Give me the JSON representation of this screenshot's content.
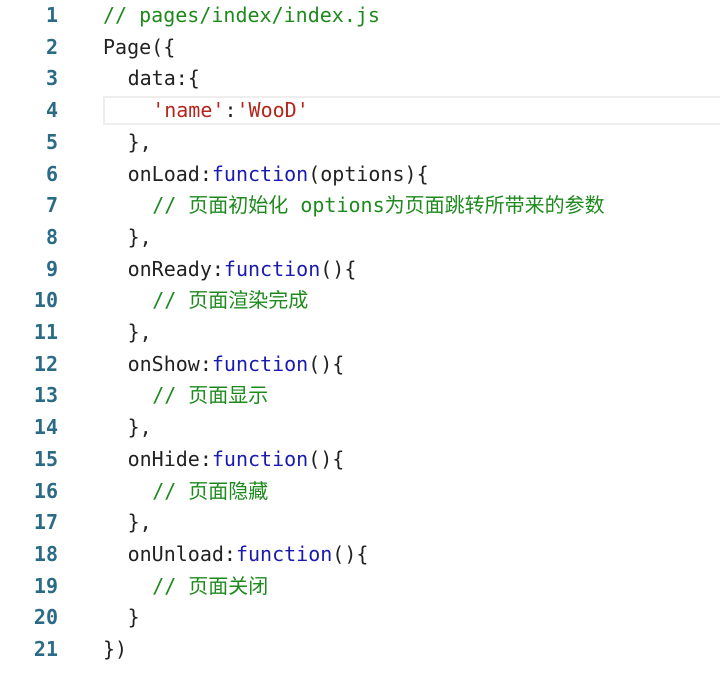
{
  "editor": {
    "colors": {
      "line_number": "#2b6b86",
      "comment": "#1e8a1e",
      "string": "#b3261e",
      "keyword": "#1a1ab0",
      "text": "#222222"
    },
    "lines": [
      {
        "num": "1",
        "indent": 0,
        "tokens": [
          {
            "t": "// pages/index/index.js",
            "k": "comment"
          }
        ]
      },
      {
        "num": "2",
        "indent": 0,
        "tokens": [
          {
            "t": "Page({",
            "k": "plain"
          }
        ]
      },
      {
        "num": "3",
        "indent": 1,
        "tokens": [
          {
            "t": "data:{",
            "k": "plain"
          }
        ]
      },
      {
        "num": "4",
        "indent": 2,
        "current": true,
        "tokens": [
          {
            "t": "'name'",
            "k": "string"
          },
          {
            "t": ":",
            "k": "plain"
          },
          {
            "t": "'WooD'",
            "k": "string"
          }
        ]
      },
      {
        "num": "5",
        "indent": 1,
        "tokens": [
          {
            "t": "},",
            "k": "plain"
          }
        ]
      },
      {
        "num": "6",
        "indent": 1,
        "tokens": [
          {
            "t": "onLoad:",
            "k": "plain"
          },
          {
            "t": "function",
            "k": "keyword"
          },
          {
            "t": "(options){",
            "k": "plain"
          }
        ]
      },
      {
        "num": "7",
        "indent": 2,
        "tokens": [
          {
            "t": "// 页面初始化 options为页面跳转所带来的参数",
            "k": "comment"
          }
        ]
      },
      {
        "num": "8",
        "indent": 1,
        "tokens": [
          {
            "t": "},",
            "k": "plain"
          }
        ]
      },
      {
        "num": "9",
        "indent": 1,
        "tokens": [
          {
            "t": "onReady:",
            "k": "plain"
          },
          {
            "t": "function",
            "k": "keyword"
          },
          {
            "t": "(){",
            "k": "plain"
          }
        ]
      },
      {
        "num": "10",
        "indent": 2,
        "tokens": [
          {
            "t": "// 页面渲染完成",
            "k": "comment"
          }
        ]
      },
      {
        "num": "11",
        "indent": 1,
        "tokens": [
          {
            "t": "},",
            "k": "plain"
          }
        ]
      },
      {
        "num": "12",
        "indent": 1,
        "tokens": [
          {
            "t": "onShow:",
            "k": "plain"
          },
          {
            "t": "function",
            "k": "keyword"
          },
          {
            "t": "(){",
            "k": "plain"
          }
        ]
      },
      {
        "num": "13",
        "indent": 2,
        "tokens": [
          {
            "t": "// 页面显示",
            "k": "comment"
          }
        ]
      },
      {
        "num": "14",
        "indent": 1,
        "tokens": [
          {
            "t": "},",
            "k": "plain"
          }
        ]
      },
      {
        "num": "15",
        "indent": 1,
        "tokens": [
          {
            "t": "onHide:",
            "k": "plain"
          },
          {
            "t": "function",
            "k": "keyword"
          },
          {
            "t": "(){",
            "k": "plain"
          }
        ]
      },
      {
        "num": "16",
        "indent": 2,
        "tokens": [
          {
            "t": "// 页面隐藏",
            "k": "comment"
          }
        ]
      },
      {
        "num": "17",
        "indent": 1,
        "tokens": [
          {
            "t": "},",
            "k": "plain"
          }
        ]
      },
      {
        "num": "18",
        "indent": 1,
        "tokens": [
          {
            "t": "onUnload:",
            "k": "plain"
          },
          {
            "t": "function",
            "k": "keyword"
          },
          {
            "t": "(){",
            "k": "plain"
          }
        ]
      },
      {
        "num": "19",
        "indent": 2,
        "tokens": [
          {
            "t": "// 页面关闭",
            "k": "comment"
          }
        ]
      },
      {
        "num": "20",
        "indent": 1,
        "tokens": [
          {
            "t": "}",
            "k": "plain"
          }
        ]
      },
      {
        "num": "21",
        "indent": 0,
        "tokens": [
          {
            "t": "})",
            "k": "plain"
          }
        ]
      }
    ]
  }
}
